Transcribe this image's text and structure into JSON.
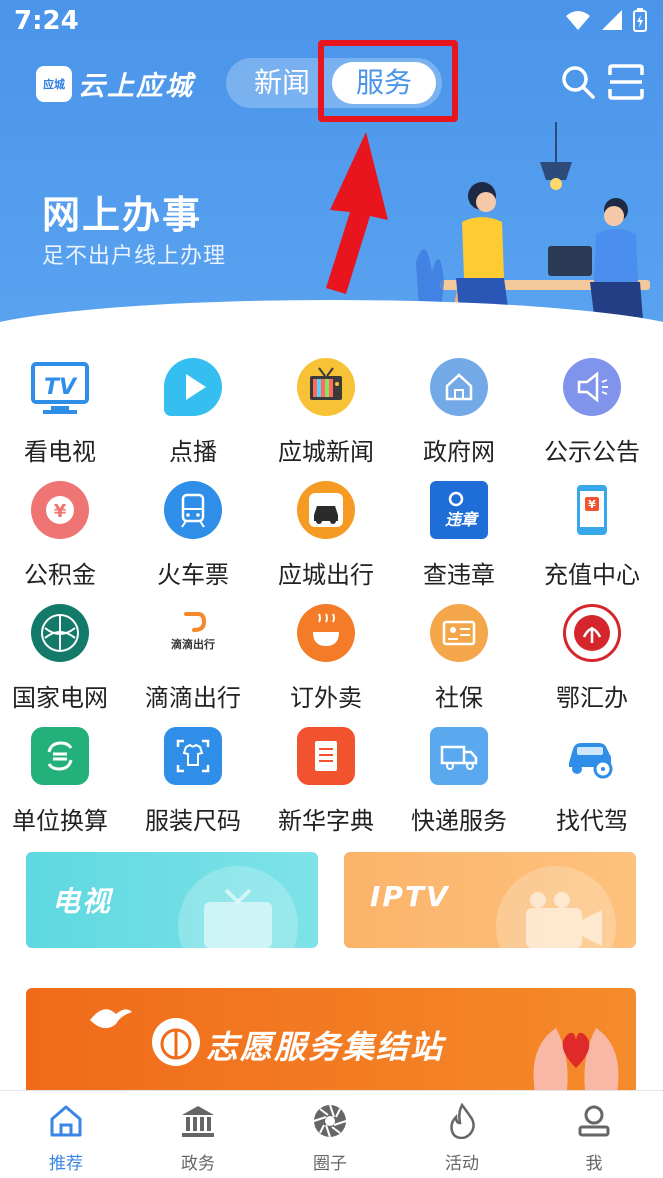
{
  "status": {
    "time": "7:24"
  },
  "appbar": {
    "logo_badge": "应城",
    "logo_text": "云上应城",
    "tabs": [
      "新闻",
      "服务"
    ],
    "active_tab": "服务"
  },
  "banner": {
    "title": "网上办事",
    "subtitle": "足不出户线上办理"
  },
  "services": [
    {
      "label": "看电视",
      "icon": "tv-icon",
      "color": "#2f8ee8"
    },
    {
      "label": "点播",
      "icon": "play-icon",
      "color": "#35bff0"
    },
    {
      "label": "应城新闻",
      "icon": "retro-tv-icon",
      "color": "#f7c236"
    },
    {
      "label": "政府网",
      "icon": "home-icon",
      "color": "#74a9e8"
    },
    {
      "label": "公示公告",
      "icon": "speaker-icon",
      "color": "#7f94ea"
    },
    {
      "label": "公积金",
      "icon": "yuan-icon",
      "color": "#ef7474"
    },
    {
      "label": "火车票",
      "icon": "train-icon",
      "color": "#2f8ee8"
    },
    {
      "label": "应城出行",
      "icon": "car-icon",
      "color": "#f59a23"
    },
    {
      "label": "查违章",
      "icon": "violation-icon",
      "color": "#1f6ed8"
    },
    {
      "label": "充值中心",
      "icon": "phone-recharge-icon",
      "color": "#38a8ec"
    },
    {
      "label": "国家电网",
      "icon": "state-grid-icon",
      "color": "#137a6a"
    },
    {
      "label": "滴滴出行",
      "icon": "didi-icon",
      "color": "#f5892a"
    },
    {
      "label": "订外卖",
      "icon": "bowl-icon",
      "color": "#f47c28"
    },
    {
      "label": "社保",
      "icon": "id-card-icon",
      "color": "#f4a64a"
    },
    {
      "label": "鄂汇办",
      "icon": "ehuiban-icon",
      "color": "#d6262d"
    },
    {
      "label": "单位换算",
      "icon": "convert-icon",
      "color": "#23b07a"
    },
    {
      "label": "服装尺码",
      "icon": "shirt-icon",
      "color": "#2f8ee8"
    },
    {
      "label": "新华字典",
      "icon": "dictionary-icon",
      "color": "#f0532e"
    },
    {
      "label": "快递服务",
      "icon": "truck-icon",
      "color": "#5aa8ee"
    },
    {
      "label": "找代驾",
      "icon": "driver-car-icon",
      "color": "#2f8ee8"
    }
  ],
  "promo": {
    "tv_label": "电视",
    "iptv_label": "IPTV"
  },
  "volunteer": {
    "title": "志愿服务集结站"
  },
  "tabbar": [
    {
      "label": "推荐",
      "active": true
    },
    {
      "label": "政务",
      "active": false
    },
    {
      "label": "圈子",
      "active": false
    },
    {
      "label": "活动",
      "active": false
    },
    {
      "label": "我",
      "active": false
    }
  ]
}
